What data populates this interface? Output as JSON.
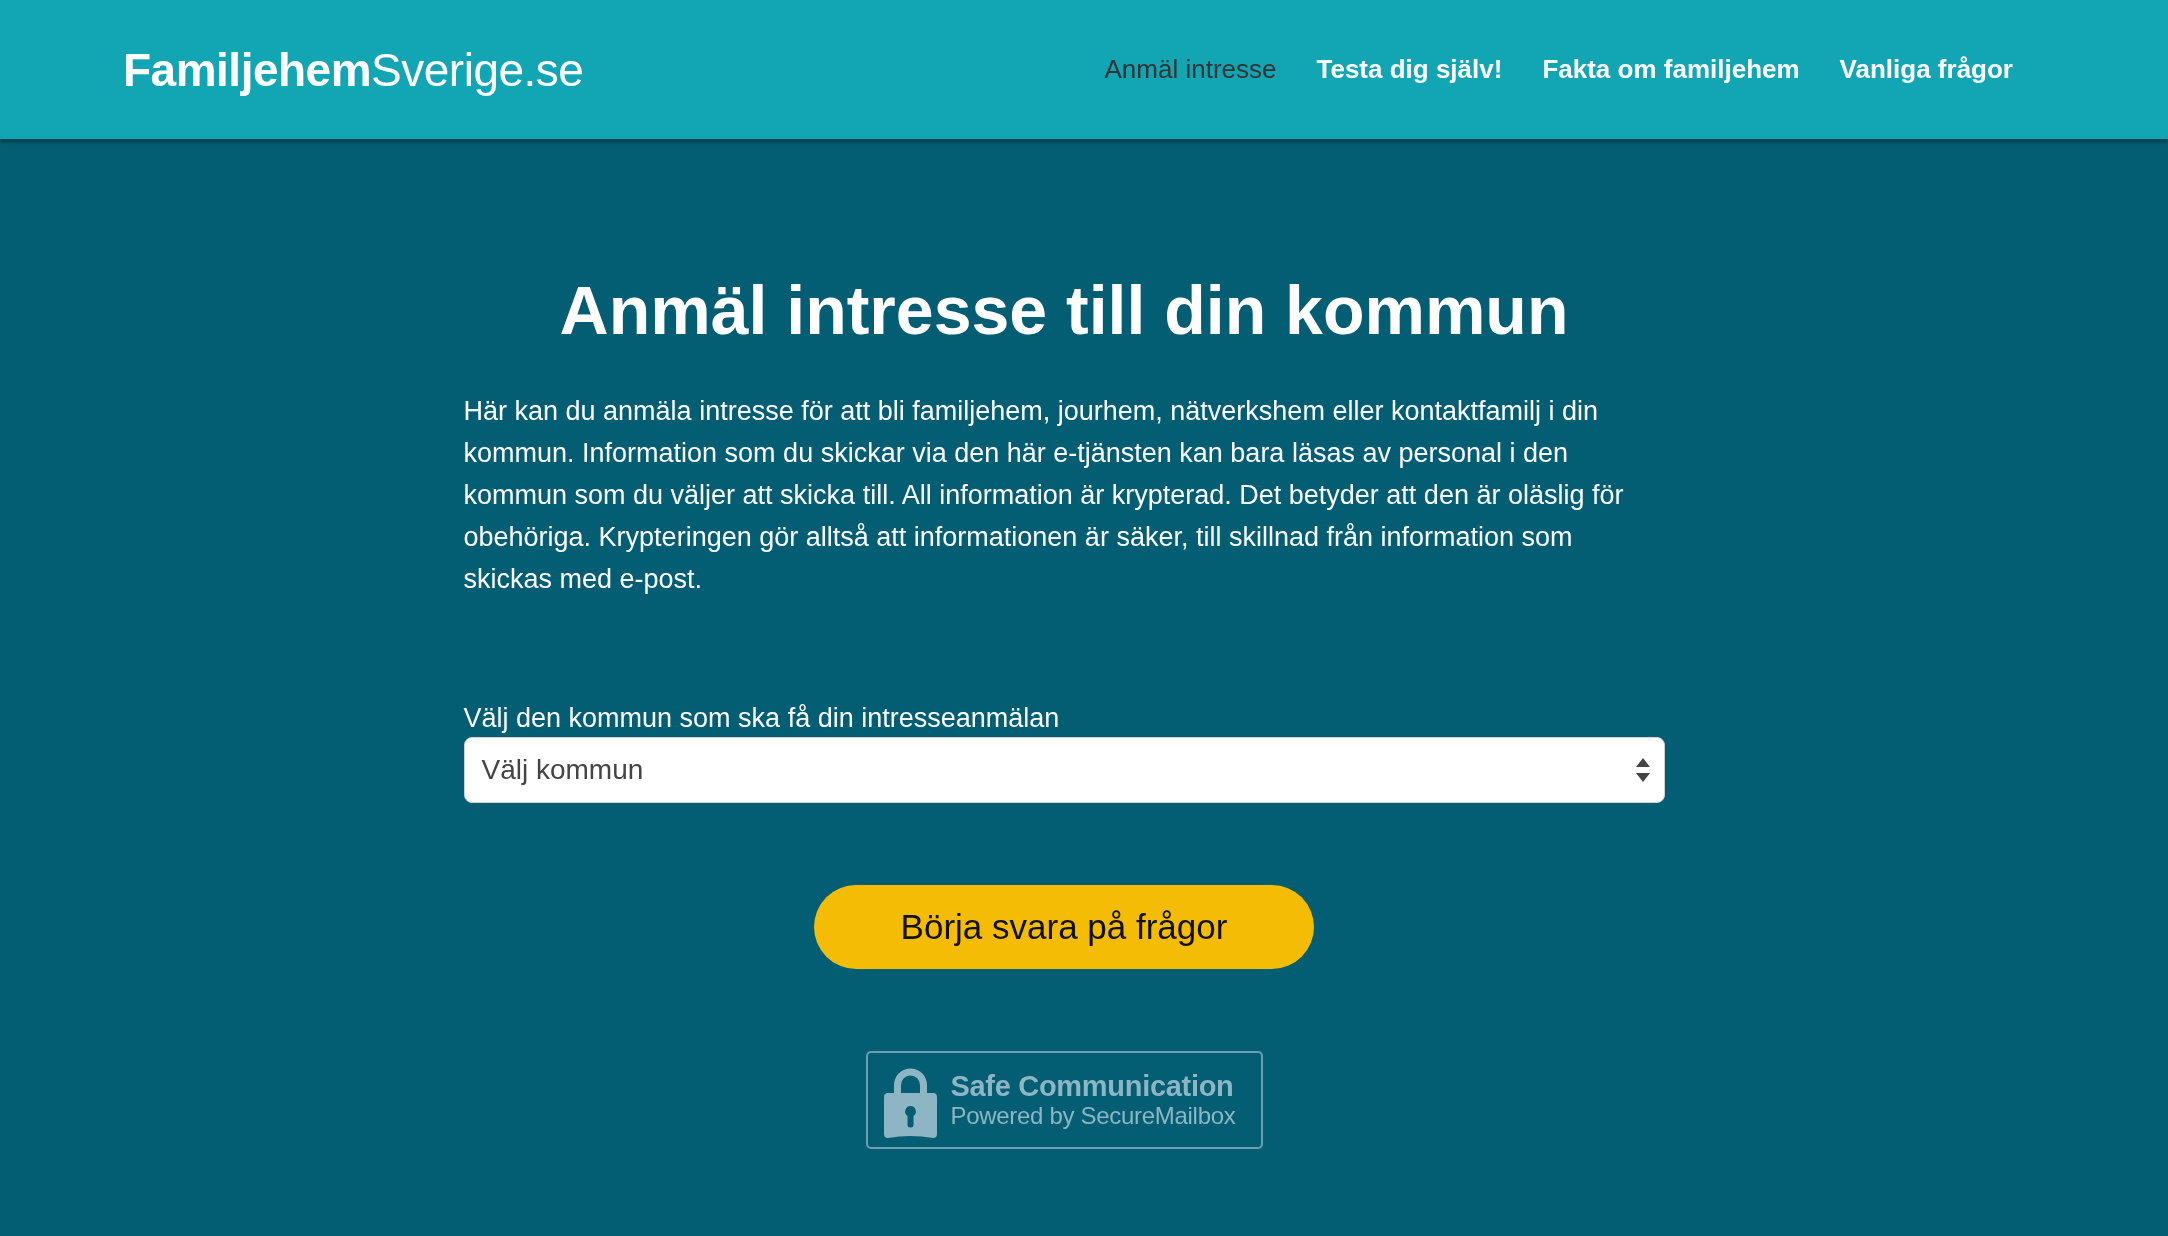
{
  "header": {
    "logo": "**Familjehem**Sverige.se",
    "nav": [
      {
        "label": "Anmäl intresse",
        "selected": true
      },
      {
        "label": "Testa dig själv!",
        "selected": false
      },
      {
        "label": "Fakta om familjehem",
        "selected": false
      },
      {
        "label": "Vanliga frågor",
        "selected": false
      }
    ]
  },
  "intro": {
    "title": "Anmäl intresse till din kommun",
    "text": "Här kan du anmäla intresse för att bli familjehem, jourhem, nätverkshem eller kontaktfamilj i din kommun. Information som du skickar via den här e-tjänsten kan bara läsas av personal i den kommun som du väljer att skicka till. All information är krypterad. Det betyder att den är oläslig för obehöriga. Krypteringen gör alltså att informationen är säker, till skillnad från information som skickas med e-post."
  },
  "form": {
    "municipality_select": {
      "label": "Välj den kommun som ska få din intresseanmälan",
      "placeholder": "Välj kommun"
    },
    "start_button": "Börja svara på frågor"
  },
  "security_badge": {
    "title": "Safe Communication",
    "subtitle": "Powered by SecureMailbox"
  }
}
